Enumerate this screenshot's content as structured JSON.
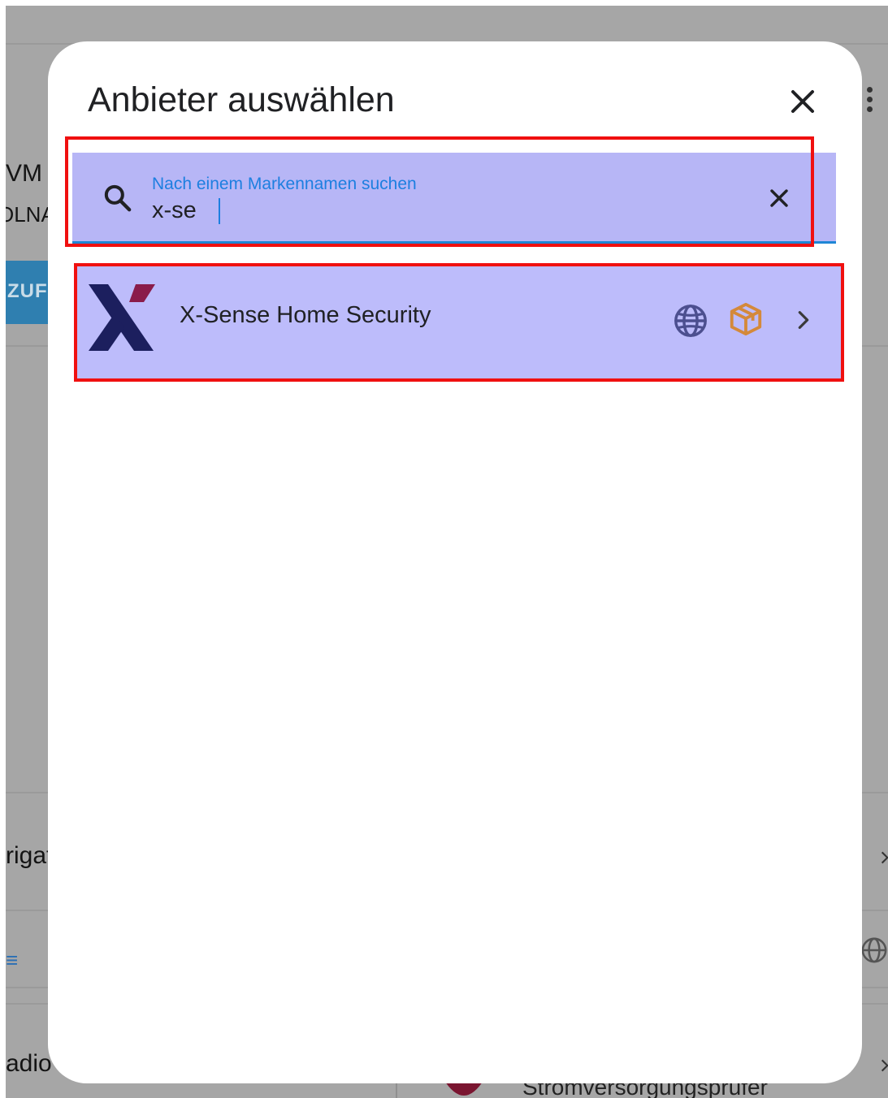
{
  "dialog": {
    "title": "Anbieter auswählen",
    "close_icon": "close-icon"
  },
  "search": {
    "label": "Nach einem Markennamen suchen",
    "value": "x-se",
    "clear_icon": "close-icon",
    "icon": "search-icon"
  },
  "results": [
    {
      "label": "X-Sense Home Security",
      "logo": "x-sense-logo",
      "badges": [
        "globe-icon",
        "package-icon"
      ],
      "action_icon": "chevron-right-icon"
    }
  ],
  "background": {
    "fragments": [
      "VM",
      "OLNA",
      "ZUF",
      "rigat",
      "adio",
      "Stromversorgungsprüfer"
    ]
  },
  "colors": {
    "highlight_fill": "#b7b6f6",
    "highlight_border": "#f01010",
    "accent_blue": "#1d7fe0",
    "package_orange": "#d4893a",
    "logo_navy": "#1c1f5e",
    "logo_maroon": "#8a1c4a"
  }
}
